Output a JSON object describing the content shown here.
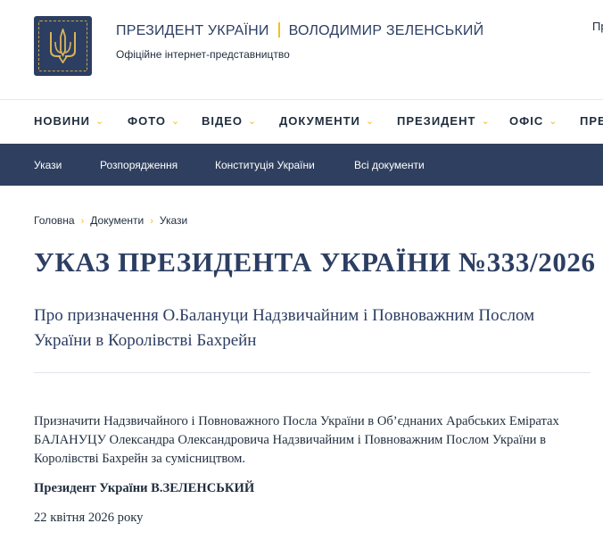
{
  "header": {
    "title_left": "ПРЕЗИДЕНТ УКРАЇНИ",
    "title_right": "ВОЛОДИМИР ЗЕЛЕНСЬКИЙ",
    "subtitle": "Офіційне інтернет-представництво",
    "lang_label": "Пр"
  },
  "main_nav": {
    "items": [
      {
        "label": "НОВИНИ"
      },
      {
        "label": "ФОТО"
      },
      {
        "label": "ВІДЕО"
      },
      {
        "label": "ДОКУМЕНТИ"
      },
      {
        "label": "ПРЕЗИДЕНТ"
      },
      {
        "label": "ОФІС"
      },
      {
        "label": "ПРЕ"
      }
    ]
  },
  "sub_nav": {
    "items": [
      {
        "label": "Укази"
      },
      {
        "label": "Розпорядження"
      },
      {
        "label": "Конституція України"
      },
      {
        "label": "Всі документи"
      }
    ]
  },
  "breadcrumb": [
    "Головна",
    "Документи",
    "Укази"
  ],
  "page": {
    "title": "УКАЗ ПРЕЗИДЕНТА УКРАЇНИ №333/2026",
    "lead": "Про призначення О.Балануци Надзвичайним і Повноважним Послом України в Королівстві Бахрейн",
    "body": "Призначити Надзвичайного і Повноважного Посла України в Об’єднаних Арабських Еміратах БАЛАНУЦУ Олександра Олександровича Надзвичайним і Повноважним Послом України в Королівстві Бахрейн за сумісництвом.",
    "signature": "Президент України В.ЗЕЛЕНСЬКИЙ",
    "date": "22 квітня 2026 року"
  },
  "colors": {
    "brand_navy": "#2c3e62",
    "subnav_bg": "#2f3f5f",
    "accent_gold": "#f2c01e"
  }
}
